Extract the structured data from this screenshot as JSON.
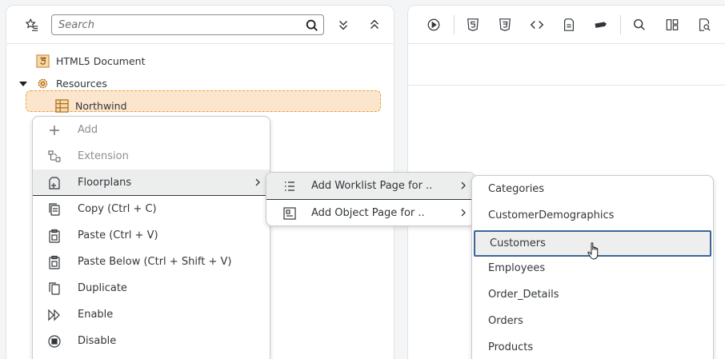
{
  "left_toolbar": {
    "favorites_icon": "star-list-icon",
    "search_placeholder": "Search",
    "expand_all_icon": "double-chevron-down-icon",
    "collapse_all_icon": "double-chevron-up-icon"
  },
  "tree": {
    "items": [
      {
        "label": "HTML5 Document",
        "icon": "html5-icon"
      },
      {
        "label": "Resources",
        "icon": "gear-icon",
        "expanded": true
      },
      {
        "label": "Northwind",
        "icon": "table-icon",
        "selected": true
      }
    ]
  },
  "context_menu": {
    "items": [
      {
        "label": "Add",
        "icon": "plus-icon",
        "disabled": true
      },
      {
        "label": "Extension",
        "icon": "extension-icon",
        "disabled": true
      },
      {
        "label": "Floorplans",
        "icon": "floorplan-icon",
        "submenu": true
      },
      {
        "label": "Copy (Ctrl + C)",
        "icon": "copy-icon"
      },
      {
        "label": "Paste (Ctrl + V)",
        "icon": "paste-icon"
      },
      {
        "label": "Paste Below (Ctrl + Shift + V)",
        "icon": "paste-below-icon"
      },
      {
        "label": "Duplicate",
        "icon": "duplicate-icon"
      },
      {
        "label": "Enable",
        "icon": "enable-icon"
      },
      {
        "label": "Disable",
        "icon": "disable-icon"
      }
    ]
  },
  "floorplans_submenu": {
    "items": [
      {
        "label": "Add Worklist Page for ..",
        "icon": "list-icon"
      },
      {
        "label": "Add Object Page for ..",
        "icon": "object-page-icon"
      }
    ]
  },
  "entities_submenu": {
    "items": [
      {
        "label": "Categories"
      },
      {
        "label": "CustomerDemographics"
      },
      {
        "label": "Customers",
        "focused": true
      },
      {
        "label": "Employees"
      },
      {
        "label": "Order_Details"
      },
      {
        "label": "Orders"
      },
      {
        "label": "Products"
      }
    ]
  },
  "right_toolbar": {
    "icons": [
      "play-icon",
      "html5-icon",
      "css3-icon",
      "code-icon",
      "document-icon",
      "tag-icon",
      "search-icon",
      "layout-icon",
      "inspect-icon"
    ]
  },
  "colors": {
    "selection_bg": "#fce5cd",
    "selection_border": "#e9a13b",
    "focus_border": "#3a6796",
    "html5_orange": "#e8a33d"
  }
}
